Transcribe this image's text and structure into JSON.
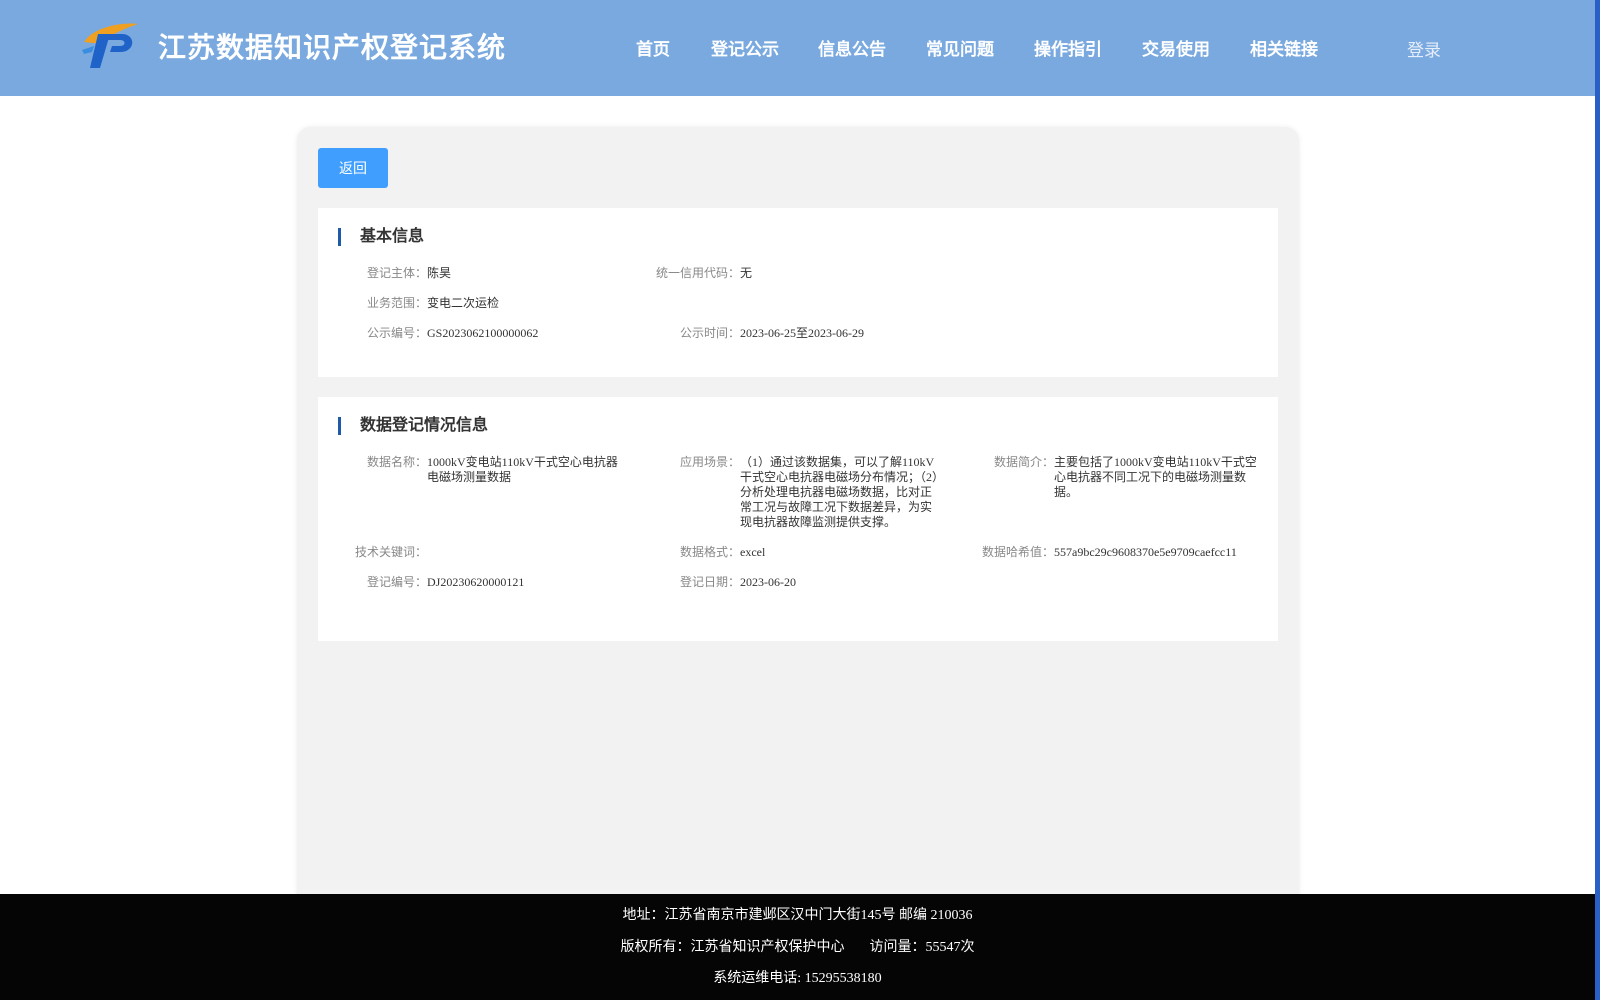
{
  "header": {
    "site_title": "江苏数据知识产权登记系统",
    "nav": [
      "首页",
      "登记公示",
      "信息公告",
      "常见问题",
      "操作指引",
      "交易使用",
      "相关链接"
    ],
    "login_label": "登录",
    "colors": {
      "header_bg": "#79a9df",
      "accent": "#409eff"
    }
  },
  "toolbar": {
    "back_label": "返回"
  },
  "basic_info": {
    "title": "基本信息",
    "subject_label": "登记主体：",
    "subject_value": "陈昊",
    "credit_code_label": "统一信用代码：",
    "credit_code_value": "无",
    "scope_label": "业务范围：",
    "scope_value": "变电二次运检",
    "notice_no_label": "公示编号：",
    "notice_no_value": "GS2023062100000062",
    "notice_time_label": "公示时间：",
    "notice_time_value": "2023-06-25至2023-06-29"
  },
  "registration_info": {
    "title": "数据登记情况信息",
    "data_name_label": "数据名称：",
    "data_name_value": "1000kV变电站110kV干式空心电抗器电磁场测量数据",
    "scenario_label": "应用场景：",
    "scenario_value": "（1）通过该数据集，可以了解110kV干式空心电抗器电磁场分布情况；（2）分析处理电抗器电磁场数据，比对正常工况与故障工况下数据差异，为实现电抗器故障监测提供支撑。",
    "intro_label": "数据简介：",
    "intro_value": "主要包括了1000kV变电站110kV干式空心电抗器不同工况下的电磁场测量数据。",
    "keywords_label": "技术关键词：",
    "keywords_value": "",
    "format_label": "数据格式：",
    "format_value": "excel",
    "hash_label": "数据哈希值：",
    "hash_value": "557a9bc29c9608370e5e9709caefcc11",
    "reg_no_label": "登记编号：",
    "reg_no_value": "DJ20230620000121",
    "reg_date_label": "登记日期：",
    "reg_date_value": "2023-06-20"
  },
  "footer": {
    "address": "地址：江苏省南京市建邺区汉中门大街145号 邮编 210036",
    "copyright": "版权所有：江苏省知识产权保护中心",
    "visits": "访问量：55547次",
    "hotline": "系统运维电话: 15295538180"
  }
}
